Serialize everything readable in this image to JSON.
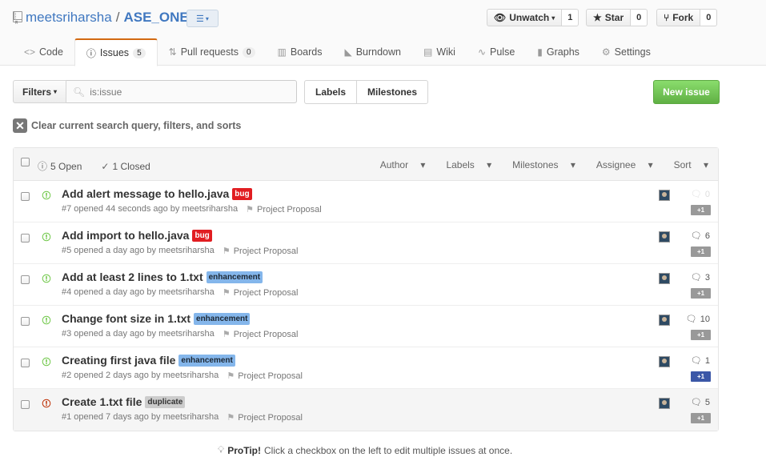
{
  "repo": {
    "owner": "meetsriharsha",
    "separator": "/",
    "name": "ASE_ONE"
  },
  "social": {
    "watch_label": "Unwatch",
    "watch_count": "1",
    "star_label": "Star",
    "star_count": "0",
    "fork_label": "Fork",
    "fork_count": "0"
  },
  "tabs": [
    {
      "label": "Code",
      "icon": "code-icon"
    },
    {
      "label": "Issues",
      "icon": "issue-opened-icon",
      "counter": "5",
      "selected": true
    },
    {
      "label": "Pull requests",
      "icon": "pull-request-icon",
      "counter": "0"
    },
    {
      "label": "Boards",
      "icon": "boards-icon"
    },
    {
      "label": "Burndown",
      "icon": "burndown-icon"
    },
    {
      "label": "Wiki",
      "icon": "wiki-icon"
    },
    {
      "label": "Pulse",
      "icon": "pulse-icon"
    },
    {
      "label": "Graphs",
      "icon": "graph-icon"
    },
    {
      "label": "Settings",
      "icon": "gear-icon"
    }
  ],
  "toolbar": {
    "filters_label": "Filters",
    "search_value": "is:issue",
    "labels_label": "Labels",
    "milestones_label": "Milestones",
    "new_issue_label": "New issue",
    "clear_query_label": "Clear current search query, filters, and sorts"
  },
  "list_header": {
    "open_label": "5 Open",
    "closed_label": "1 Closed",
    "author": "Author",
    "labels": "Labels",
    "milestones": "Milestones",
    "assignee": "Assignee",
    "sort": "Sort"
  },
  "issues": [
    {
      "title": "Add alert message to hello.java",
      "label": "bug",
      "label_type": "bug",
      "meta": "#7 opened 44 seconds ago by meetsriharsha",
      "milestone": "Project Proposal",
      "comments": "0",
      "plus": "+1",
      "state": "open"
    },
    {
      "title": "Add import to hello.java",
      "label": "bug",
      "label_type": "bug",
      "meta": "#5 opened a day ago by meetsriharsha",
      "milestone": "Project Proposal",
      "comments": "6",
      "plus": "+1",
      "state": "open"
    },
    {
      "title": "Add at least 2 lines to 1.txt",
      "label": "enhancement",
      "label_type": "enh",
      "meta": "#4 opened a day ago by meetsriharsha",
      "milestone": "Project Proposal",
      "comments": "3",
      "plus": "+1",
      "state": "open"
    },
    {
      "title": "Change font size in 1.txt",
      "label": "enhancement",
      "label_type": "enh",
      "meta": "#3 opened a day ago by meetsriharsha",
      "milestone": "Project Proposal",
      "comments": "10",
      "plus": "+1",
      "state": "open"
    },
    {
      "title": "Creating first java file",
      "label": "enhancement",
      "label_type": "enh",
      "meta": "#2 opened 2 days ago by meetsriharsha",
      "milestone": "Project Proposal",
      "comments": "1",
      "plus": "+1",
      "state": "open"
    },
    {
      "title": "Create 1.txt file",
      "label": "duplicate",
      "label_type": "dup",
      "meta": "#1 opened 7 days ago by meetsriharsha",
      "milestone": "Project Proposal",
      "comments": "5",
      "plus": "+1",
      "state": "in-progress"
    }
  ],
  "protip": {
    "strong": "ProTip!",
    "text": "Click a checkbox on the left to edit multiple issues at once."
  },
  "colors": {
    "accent_link": "#4078c0",
    "tab_highlight": "#d26911",
    "new_issue_green": "#60b044",
    "open_state_green": "#6cc644",
    "in_progress_red": "#bd2c00",
    "label_bug": "#e11d21",
    "label_enhancement": "#84b6eb",
    "label_duplicate": "#cccccc",
    "plus_one_active": "#3b57a7"
  }
}
